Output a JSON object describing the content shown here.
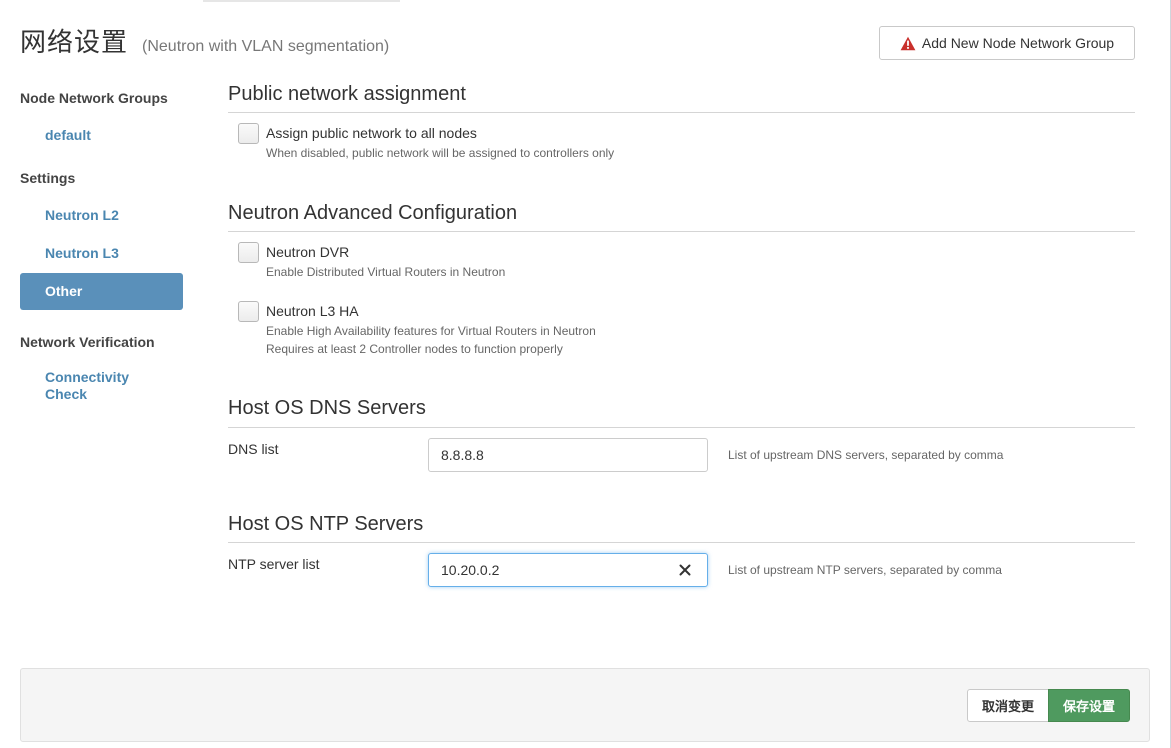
{
  "header": {
    "title": "网络设置",
    "subtitle": "(Neutron with VLAN segmentation)",
    "add_group_label": "Add New Node Network Group"
  },
  "sidebar": {
    "groups": [
      {
        "label": "Node Network Groups",
        "items": [
          {
            "label": "default",
            "active": false
          }
        ]
      },
      {
        "label": "Settings",
        "items": [
          {
            "label": "Neutron L2",
            "active": false
          },
          {
            "label": "Neutron L3",
            "active": false
          },
          {
            "label": "Other",
            "active": true
          }
        ]
      },
      {
        "label": "Network Verification",
        "items": [
          {
            "label": "Connectivity Check",
            "active": false
          }
        ]
      }
    ],
    "verification_item_line1": "Connectivity",
    "verification_item_line2": "Check"
  },
  "sections": {
    "public_network": {
      "title": "Public network assignment",
      "checkbox_label": "Assign public network to all nodes",
      "checkbox_checked": false,
      "description": "When disabled, public network will be assigned to controllers only"
    },
    "neutron_advanced": {
      "title": "Neutron Advanced Configuration",
      "dvr_label": "Neutron DVR",
      "dvr_checked": false,
      "dvr_description": "Enable Distributed Virtual Routers in Neutron",
      "l3ha_label": "Neutron L3 HA",
      "l3ha_checked": false,
      "l3ha_description_1": "Enable High Availability features for Virtual Routers in Neutron",
      "l3ha_description_2": "Requires at least 2 Controller nodes to function properly"
    },
    "dns": {
      "title": "Host OS DNS Servers",
      "label": "DNS list",
      "value": "8.8.8.8",
      "help": "List of upstream DNS servers, separated by comma"
    },
    "ntp": {
      "title": "Host OS NTP Servers",
      "label": "NTP server list",
      "value": "10.20.0.2",
      "help": "List of upstream NTP servers, separated by comma"
    }
  },
  "footer": {
    "cancel_label": "取消变更",
    "save_label": "保存设置"
  },
  "colors": {
    "link": "#4a86b0",
    "active_nav": "#5a90ba",
    "save": "#4f9a5f",
    "warning": "#c9302c"
  }
}
